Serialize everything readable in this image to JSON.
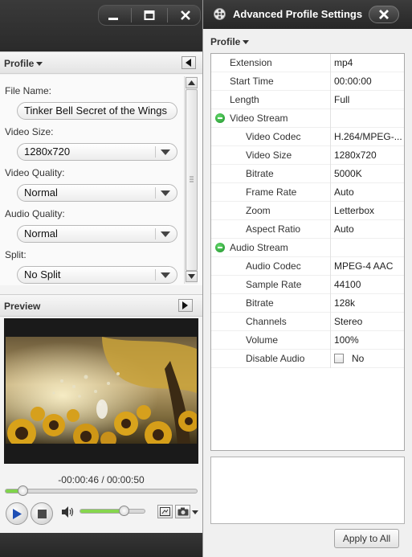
{
  "left_panel": {
    "profile_section": {
      "title": "Profile",
      "fields": [
        {
          "label": "File Name:",
          "value": "Tinker Bell Secret of the Wings",
          "type": "text"
        },
        {
          "label": "Video Size:",
          "value": "1280x720",
          "type": "select"
        },
        {
          "label": "Video Quality:",
          "value": "Normal",
          "type": "select"
        },
        {
          "label": "Audio Quality:",
          "value": "Normal",
          "type": "select"
        },
        {
          "label": "Split:",
          "value": "No Split",
          "type": "select"
        }
      ]
    },
    "preview_section": {
      "title": "Preview",
      "timecode": "-00:00:46 / 00:00:50",
      "seek_progress": 0.09,
      "volume_level": 0.67
    }
  },
  "right_panel": {
    "title": "Advanced Profile Settings",
    "profile_label": "Profile",
    "rows": [
      {
        "key": "Extension",
        "value": "mp4",
        "level": 0
      },
      {
        "key": "Start Time",
        "value": "00:00:00",
        "level": 0
      },
      {
        "key": "Length",
        "value": "Full",
        "level": 0
      },
      {
        "key": "Video Stream",
        "value": "",
        "level": "group"
      },
      {
        "key": "Video Codec",
        "value": "H.264/MPEG-...",
        "level": 1
      },
      {
        "key": "Video Size",
        "value": "1280x720",
        "level": 1
      },
      {
        "key": "Bitrate",
        "value": "5000K",
        "level": 1
      },
      {
        "key": "Frame Rate",
        "value": "Auto",
        "level": 1
      },
      {
        "key": "Zoom",
        "value": "Letterbox",
        "level": 1
      },
      {
        "key": "Aspect Ratio",
        "value": "Auto",
        "level": 1
      },
      {
        "key": "Audio Stream",
        "value": "",
        "level": "group"
      },
      {
        "key": "Audio Codec",
        "value": "MPEG-4 AAC",
        "level": 1
      },
      {
        "key": "Sample Rate",
        "value": "44100",
        "level": 1
      },
      {
        "key": "Bitrate",
        "value": "128k",
        "level": 1
      },
      {
        "key": "Channels",
        "value": "Stereo",
        "level": 1
      },
      {
        "key": "Volume",
        "value": "100%",
        "level": 1
      },
      {
        "key": "Disable Audio",
        "value": "No",
        "level": 1,
        "checkbox": true,
        "checked": false
      }
    ],
    "apply_button": "Apply to All"
  },
  "colors": {
    "accent_green": "#7fd34a",
    "titlebar_dark": "#2a2a2a",
    "group_icon_green": "#1d8f2a"
  },
  "icons": [
    "minimize-icon",
    "maximize-icon",
    "close-icon",
    "collapse-left-icon",
    "expand-right-icon",
    "play-icon",
    "stop-icon",
    "speaker-icon",
    "snapshot-icon",
    "camera-icon",
    "film-reel-icon",
    "collapse-group-icon"
  ]
}
